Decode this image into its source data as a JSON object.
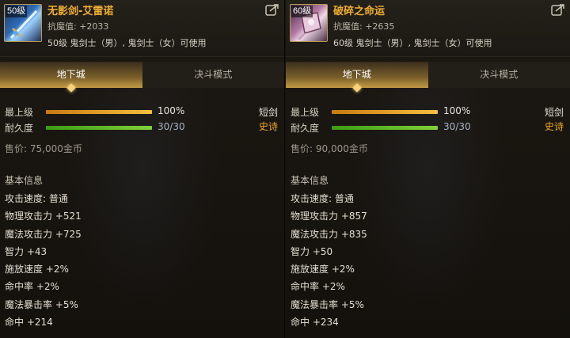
{
  "items": [
    {
      "level_tag": "50级",
      "name": "无影剑-艾雷诺",
      "resist": "抗魔值: +2033",
      "usable": "50级 鬼剑士（男）, 鬼剑士（女）可使用",
      "icon": "sword-icon",
      "tabs": [
        "地下城",
        "决斗模式"
      ],
      "max_level_label": "最上级",
      "max_level_value": "100%",
      "max_level_fill": 1.0,
      "durability_label": "耐久度",
      "durability_value": "30/30",
      "durability_fill": 1.0,
      "type_label": "短剑",
      "rarity_label": "史诗",
      "price": "售价: 75,000金币",
      "section_title": "基本信息",
      "attributes": [
        "攻击速度: 普通",
        "物理攻击力 +521",
        "魔法攻击力 +725",
        "智力 +43",
        "施放速度 +2%",
        "命中率 +2%",
        "魔法暴击率 +5%",
        "命中 +214"
      ]
    },
    {
      "level_tag": "60级",
      "name": "破碎之命运",
      "resist": "抗魔值: +2635",
      "usable": "60级 鬼剑士（男）, 鬼剑士（女）可使用",
      "icon": "cube-weapon-icon",
      "tabs": [
        "地下城",
        "决斗模式"
      ],
      "max_level_label": "最上级",
      "max_level_value": "100%",
      "max_level_fill": 1.0,
      "durability_label": "耐久度",
      "durability_value": "30/30",
      "durability_fill": 1.0,
      "type_label": "短剑",
      "rarity_label": "史诗",
      "price": "售价: 90,000金币",
      "section_title": "基本信息",
      "attributes": [
        "攻击速度: 普通",
        "物理攻击力 +857",
        "魔法攻击力 +835",
        "智力 +50",
        "施放速度 +2%",
        "命中率 +2%",
        "魔法暴击率 +5%",
        "命中 +234"
      ]
    }
  ],
  "colors": {
    "name": "#f0b030",
    "rarity": "#f0a820",
    "tab_active": "#c19a44"
  }
}
